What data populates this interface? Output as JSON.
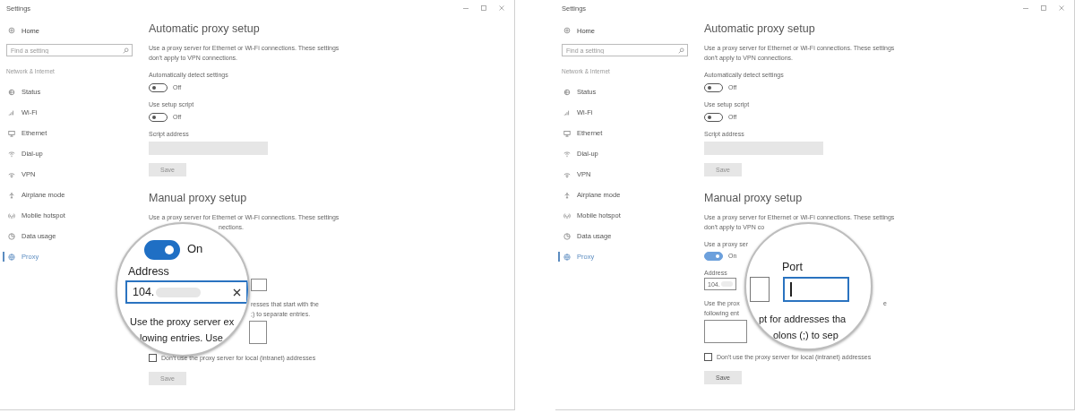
{
  "windows": [
    {
      "title": "Settings",
      "sidebar": {
        "home": "Home",
        "search_placeholder": "Find a setting",
        "section": "Network & Internet",
        "items": [
          {
            "label": "Status",
            "selected": false
          },
          {
            "label": "Wi-Fi",
            "selected": false
          },
          {
            "label": "Ethernet",
            "selected": false
          },
          {
            "label": "Dial-up",
            "selected": false
          },
          {
            "label": "VPN",
            "selected": false
          },
          {
            "label": "Airplane mode",
            "selected": false
          },
          {
            "label": "Mobile hotspot",
            "selected": false
          },
          {
            "label": "Data usage",
            "selected": false
          },
          {
            "label": "Proxy",
            "selected": true
          }
        ]
      },
      "automatic": {
        "heading": "Automatic proxy setup",
        "description": "Use a proxy server for Ethernet or Wi-Fi connections. These settings don't apply to VPN connections.",
        "settings": [
          {
            "label": "Automatically detect settings",
            "on": false,
            "state_text": "Off"
          },
          {
            "label": "Use setup script",
            "on": false,
            "state_text": "Off"
          }
        ],
        "script_address_label": "Script address",
        "save": {
          "label": "Save",
          "disabled": true
        }
      },
      "manual": {
        "heading": "Manual proxy setup",
        "rows": [
          {
            "kind": "text",
            "lines": [
              [
                "Use a proxy server for Ethernet or Wi-Fi connections. These settings"
              ],
              [
                "nections."
              ]
            ]
          },
          {
            "kind": "field",
            "focused": false
          },
          {
            "kind": "text",
            "lines": [
              [
                "resses that start with the"
              ],
              [
                ";) to separate entries."
              ]
            ]
          },
          {
            "kind": "textarea"
          },
          {
            "kind": "checkbox",
            "label": "Don't use the proxy server for local (intranet) addresses",
            "checked": false
          },
          {
            "kind": "button",
            "label": "Save",
            "disabled": true
          }
        ]
      },
      "magnifier": {
        "rows": [
          {
            "kind": "toggle",
            "on": true,
            "state_text": "On"
          },
          {
            "kind": "label",
            "text": "Address"
          },
          {
            "kind": "field",
            "value": "104.",
            "redacted": true,
            "focused": true,
            "clearable": true
          },
          {
            "kind": "text",
            "lines": [
              [
                "Use the proxy server ex"
              ],
              [
                "lowing entries. Use"
              ]
            ]
          }
        ]
      }
    },
    {
      "title": "Settings",
      "sidebar": {
        "home": "Home",
        "search_placeholder": "Find a setting",
        "section": "Network & Internet",
        "items": [
          {
            "label": "Status",
            "selected": false
          },
          {
            "label": "Wi-Fi",
            "selected": false
          },
          {
            "label": "Ethernet",
            "selected": false
          },
          {
            "label": "Dial-up",
            "selected": false
          },
          {
            "label": "VPN",
            "selected": false
          },
          {
            "label": "Airplane mode",
            "selected": false
          },
          {
            "label": "Mobile hotspot",
            "selected": false
          },
          {
            "label": "Data usage",
            "selected": false
          },
          {
            "label": "Proxy",
            "selected": true
          }
        ]
      },
      "automatic": {
        "heading": "Automatic proxy setup",
        "description": "Use a proxy server for Ethernet or Wi-Fi connections. These settings don't apply to VPN connections.",
        "settings": [
          {
            "label": "Automatically detect settings",
            "on": false,
            "state_text": "Off"
          },
          {
            "label": "Use setup script",
            "on": false,
            "state_text": "Off"
          }
        ],
        "script_address_label": "Script address",
        "save": {
          "label": "Save",
          "disabled": true
        }
      },
      "manual": {
        "heading": "Manual proxy setup",
        "rows": [
          {
            "kind": "text",
            "lines": [
              [
                "Use a proxy server for Ethernet or Wi-Fi connections. These settings"
              ],
              [
                "don't apply to VPN co"
              ]
            ]
          },
          {
            "kind": "text",
            "lines": [
              [
                "Use a proxy ser"
              ]
            ]
          },
          {
            "kind": "toggle",
            "on": true,
            "state_text": "On"
          },
          {
            "kind": "text",
            "lines": [
              [
                "Address"
              ]
            ]
          },
          {
            "kind": "field",
            "value": "104.",
            "redacted": true,
            "focused": false
          },
          {
            "kind": "text",
            "lines": [
              [
                "Use the prox",
                "e"
              ],
              [
                "following ent"
              ]
            ]
          },
          {
            "kind": "textarea"
          },
          {
            "kind": "checkbox",
            "label": "Don't use the proxy server for local (intranet) addresses",
            "checked": false
          },
          {
            "kind": "button",
            "label": "Save",
            "disabled": false
          }
        ]
      },
      "magnifier": {
        "rows": [
          {
            "kind": "field",
            "focused": false
          },
          {
            "kind": "label",
            "text": "Port"
          },
          {
            "kind": "field",
            "focused": true
          },
          {
            "kind": "text",
            "lines": [
              [
                "pt for addresses tha"
              ],
              [
                "olons (;) to sep"
              ]
            ]
          }
        ]
      }
    }
  ]
}
